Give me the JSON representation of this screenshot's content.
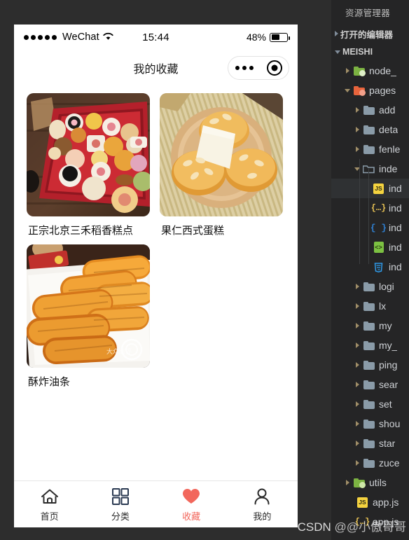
{
  "phone": {
    "status_bar": {
      "carrier": "WeChat",
      "signal_dots": 5,
      "wifi_icon": "wifi-icon",
      "time": "15:44",
      "battery_percent": "48%",
      "battery_level": 48
    },
    "nav_bar": {
      "title": "我的收藏",
      "capsule": {
        "more_icon": "more-dots-icon",
        "target_icon": "target-circle-icon"
      }
    },
    "favorites": [
      {
        "name": "正宗北京三禾稻香糕点",
        "image": "assorted-chinese-pastries-in-red-box"
      },
      {
        "name": "果仁西式蛋糕",
        "image": "almond-western-cupcakes-on-wooden-plate"
      },
      {
        "name": "酥炸油条",
        "image": "fried-youtiao-dough-sticks-on-white-plate"
      }
    ],
    "tabbar": [
      {
        "label": "首页",
        "icon": "home-icon",
        "active": false
      },
      {
        "label": "分类",
        "icon": "grid-categories-icon",
        "active": false
      },
      {
        "label": "收藏",
        "icon": "heart-icon",
        "active": true
      },
      {
        "label": "我的",
        "icon": "person-icon",
        "active": false
      }
    ],
    "accent_color": "#f2675c"
  },
  "vscode": {
    "panel_title": "资源管理器",
    "sections": [
      {
        "label": "打开的编辑器",
        "expanded": false
      },
      {
        "label": "MEISHI",
        "expanded": true
      }
    ],
    "tree": [
      {
        "name": "node_",
        "type": "folder",
        "icon": "folder-green-icon",
        "indent": 1,
        "expanded": false,
        "selected": false
      },
      {
        "name": "pages",
        "type": "folder",
        "icon": "folder-orange-icon",
        "indent": 1,
        "expanded": true,
        "selected": false
      },
      {
        "name": "add",
        "type": "folder",
        "icon": "folder-blue-icon",
        "indent": 2,
        "expanded": false,
        "selected": false
      },
      {
        "name": "deta",
        "type": "folder",
        "icon": "folder-blue-icon",
        "indent": 2,
        "expanded": false,
        "selected": false
      },
      {
        "name": "fenle",
        "type": "folder",
        "icon": "folder-blue-icon",
        "indent": 2,
        "expanded": false,
        "selected": false
      },
      {
        "name": "inde",
        "type": "folder",
        "icon": "folder-open-blue-icon",
        "indent": 2,
        "expanded": true,
        "selected": false
      },
      {
        "name": "ind",
        "type": "file",
        "icon": "js-file-icon",
        "indent": 3,
        "selected": true
      },
      {
        "name": "ind",
        "type": "file",
        "icon": "json-file-icon",
        "indent": 3,
        "selected": false
      },
      {
        "name": "ind",
        "type": "file",
        "icon": "wxml-file-icon",
        "indent": 3,
        "selected": false
      },
      {
        "name": "ind",
        "type": "file",
        "icon": "html-file-icon",
        "indent": 3,
        "selected": false
      },
      {
        "name": "ind",
        "type": "file",
        "icon": "css-file-icon",
        "indent": 3,
        "selected": false
      },
      {
        "name": "logi",
        "type": "folder",
        "icon": "folder-blue-icon",
        "indent": 2,
        "expanded": false,
        "selected": false
      },
      {
        "name": "lx",
        "type": "folder",
        "icon": "folder-blue-icon",
        "indent": 2,
        "expanded": false,
        "selected": false
      },
      {
        "name": "my",
        "type": "folder",
        "icon": "folder-blue-icon",
        "indent": 2,
        "expanded": false,
        "selected": false
      },
      {
        "name": "my_",
        "type": "folder",
        "icon": "folder-blue-icon",
        "indent": 2,
        "expanded": false,
        "selected": false
      },
      {
        "name": "ping",
        "type": "folder",
        "icon": "folder-blue-icon",
        "indent": 2,
        "expanded": false,
        "selected": false
      },
      {
        "name": "sear",
        "type": "folder",
        "icon": "folder-blue-icon",
        "indent": 2,
        "expanded": false,
        "selected": false
      },
      {
        "name": "set",
        "type": "folder",
        "icon": "folder-blue-icon",
        "indent": 2,
        "expanded": false,
        "selected": false
      },
      {
        "name": "shou",
        "type": "folder",
        "icon": "folder-blue-icon",
        "indent": 2,
        "expanded": false,
        "selected": false
      },
      {
        "name": "star",
        "type": "folder",
        "icon": "folder-blue-icon",
        "indent": 2,
        "expanded": false,
        "selected": false
      },
      {
        "name": "zuce",
        "type": "folder",
        "icon": "folder-blue-icon",
        "indent": 2,
        "expanded": false,
        "selected": false
      },
      {
        "name": "utils",
        "type": "folder",
        "icon": "folder-green-icon",
        "indent": 1,
        "expanded": false,
        "selected": false
      },
      {
        "name": "app.js",
        "type": "file",
        "icon": "js-file-icon",
        "indent": 1,
        "selected": false
      },
      {
        "name": "app.js",
        "type": "file",
        "icon": "json-file-icon",
        "indent": 1,
        "selected": false
      }
    ]
  },
  "watermark": {
    "prefix": "CSDN",
    "handle": "@@小傲哥哥"
  }
}
